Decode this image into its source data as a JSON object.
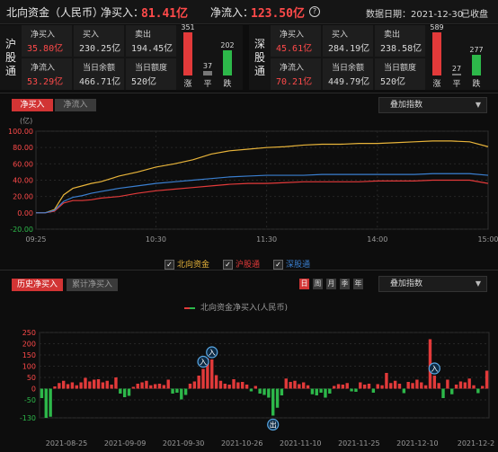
{
  "header": {
    "title": "北向资金（人民币）",
    "net_buy_label": "净买入：",
    "net_buy_value": "81.41亿",
    "net_inflow_label": "净流入：",
    "net_inflow_value": "123.50亿",
    "help_icon": "?",
    "date_label": "数据日期：2021-12-30",
    "status": "已收盘"
  },
  "sh": {
    "name": "沪股通",
    "cells": [
      {
        "label": "净买入",
        "value": "35.80亿",
        "red": true
      },
      {
        "label": "买入",
        "value": "230.25亿",
        "red": false
      },
      {
        "label": "卖出",
        "value": "194.45亿",
        "red": false
      },
      {
        "label": "净流入",
        "value": "53.29亿",
        "red": true
      },
      {
        "label": "当日余额",
        "value": "466.71亿",
        "red": false
      },
      {
        "label": "当日额度",
        "value": "520亿",
        "red": false
      }
    ],
    "up": {
      "count": "351",
      "label": "涨"
    },
    "flat": {
      "count": "37",
      "label": "平"
    },
    "down": {
      "count": "202",
      "label": "跌"
    }
  },
  "sz": {
    "name": "深股通",
    "cells": [
      {
        "label": "净买入",
        "value": "45.61亿",
        "red": true
      },
      {
        "label": "买入",
        "value": "284.19亿",
        "red": false
      },
      {
        "label": "卖出",
        "value": "238.58亿",
        "red": false
      },
      {
        "label": "净流入",
        "value": "70.21亿",
        "red": true
      },
      {
        "label": "当日余额",
        "value": "449.79亿",
        "red": false
      },
      {
        "label": "当日额度",
        "value": "520亿",
        "red": false
      }
    ],
    "up": {
      "count": "589",
      "label": "涨"
    },
    "flat": {
      "count": "27",
      "label": "平"
    },
    "down": {
      "count": "277",
      "label": "跌"
    }
  },
  "intraday": {
    "tabs": [
      "净买入",
      "净流入"
    ],
    "active_tab": 0,
    "overlay_label": "叠加指数",
    "unit": "(亿)",
    "legend": [
      {
        "name": "北向资金",
        "color": "#e8b43a"
      },
      {
        "name": "沪股通",
        "color": "#e23a3a"
      },
      {
        "name": "深股通",
        "color": "#3a7fd0"
      }
    ]
  },
  "history": {
    "tabs": [
      "历史净买入",
      "累计净买入"
    ],
    "active_tab": 0,
    "periods": [
      "日",
      "周",
      "月",
      "季",
      "年"
    ],
    "active_period": 0,
    "overlay_label": "叠加指数",
    "legend": "北向资金净买入(人民币)",
    "markers": [
      {
        "text": "入",
        "type": "in"
      },
      {
        "text": "入",
        "type": "in"
      },
      {
        "text": "入",
        "type": "in"
      },
      {
        "text": "出",
        "type": "out"
      }
    ]
  },
  "colors": {
    "red": "#ff4a4a",
    "green": "#2db84a",
    "gold": "#e8b43a",
    "blue": "#3a7fd0"
  },
  "chart_data": [
    {
      "type": "line",
      "title": "",
      "xlabel": "",
      "ylabel": "(亿)",
      "ylim": [
        -20,
        100
      ],
      "yticks": [
        100.0,
        80.0,
        60.0,
        40.0,
        20.0,
        0.0,
        -20.0
      ],
      "xticks": [
        "09:25",
        "10:30",
        "11:30",
        "14:00",
        "15:00"
      ],
      "x": [
        "09:25",
        "09:30",
        "09:35",
        "09:40",
        "09:45",
        "09:50",
        "09:55",
        "10:00",
        "10:10",
        "10:20",
        "10:30",
        "10:40",
        "10:50",
        "11:00",
        "11:10",
        "11:20",
        "11:30",
        "13:10",
        "13:20",
        "13:30",
        "13:40",
        "13:50",
        "14:00",
        "14:10",
        "14:20",
        "14:30",
        "14:40",
        "14:50",
        "15:00"
      ],
      "series": [
        {
          "name": "北向资金",
          "values": [
            0,
            0,
            4,
            22,
            30,
            33,
            36,
            38,
            45,
            50,
            56,
            60,
            65,
            72,
            76,
            78,
            80,
            81,
            83,
            84,
            84,
            85,
            85,
            86,
            87,
            88,
            88,
            87,
            81
          ]
        },
        {
          "name": "沪股通",
          "values": [
            0,
            0,
            2,
            12,
            15,
            15,
            16,
            18,
            20,
            24,
            27,
            29,
            31,
            33,
            35,
            36,
            36,
            37,
            38,
            38,
            38,
            38,
            39,
            39,
            39,
            40,
            40,
            40,
            36
          ]
        },
        {
          "name": "深股通",
          "values": [
            0,
            0,
            3,
            14,
            19,
            21,
            24,
            26,
            30,
            33,
            36,
            38,
            40,
            42,
            44,
            45,
            46,
            46,
            46,
            47,
            47,
            47,
            47,
            47,
            47,
            48,
            48,
            48,
            46
          ]
        }
      ]
    },
    {
      "type": "bar",
      "title": "",
      "ylim": [
        -130,
        250
      ],
      "yticks": [
        250,
        200,
        150,
        100,
        50,
        0,
        -50,
        -130
      ],
      "xticks": [
        "2021-08-25",
        "2021-09-09",
        "2021-09-30",
        "2021-10-26",
        "2021-11-10",
        "2021-11-25",
        "2021-12-10",
        "2021-12-2"
      ],
      "series": [
        {
          "name": "北向资金净买入(人民币)",
          "values": [
            -42,
            -130,
            -125,
            10,
            25,
            35,
            20,
            28,
            15,
            28,
            48,
            32,
            40,
            42,
            28,
            35,
            18,
            50,
            -22,
            -38,
            -32,
            8,
            22,
            28,
            35,
            15,
            20,
            22,
            16,
            40,
            -22,
            -18,
            -48,
            -28,
            22,
            32,
            58,
            88,
            135,
            130,
            60,
            35,
            22,
            18,
            42,
            28,
            30,
            18,
            -12,
            12,
            -22,
            -28,
            -40,
            -120,
            -85,
            -30,
            45,
            30,
            35,
            20,
            28,
            15,
            -25,
            -30,
            -18,
            -40,
            -22,
            12,
            20,
            18,
            25,
            -12,
            -14,
            28,
            18,
            22,
            -18,
            20,
            15,
            70,
            25,
            35,
            22,
            -20,
            30,
            25,
            40,
            28,
            15,
            220,
            58,
            25,
            -42,
            40,
            -25,
            18,
            32,
            28,
            45,
            15,
            -20,
            12,
            80
          ]
        }
      ]
    }
  ]
}
